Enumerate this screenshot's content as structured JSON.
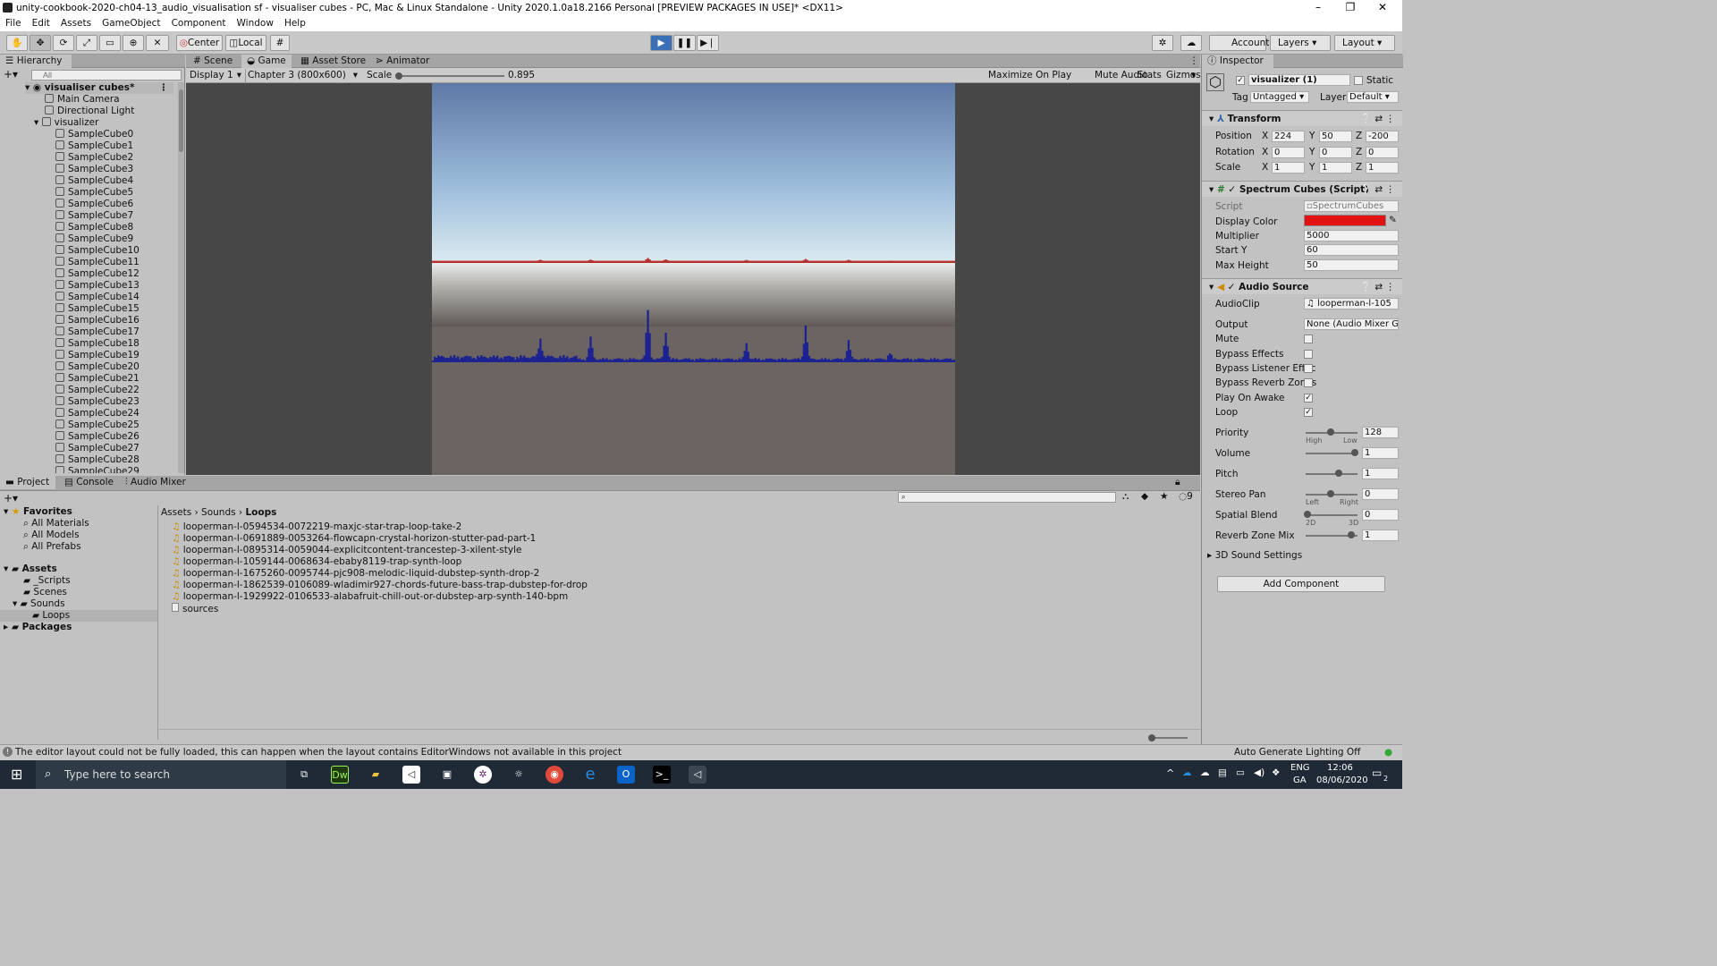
{
  "window": {
    "title": "unity-cookbook-2020-ch04-13_audio_visualisation sf - visualiser cubes - PC, Mac & Linux Standalone - Unity 2020.1.0a18.2166 Personal [PREVIEW PACKAGES IN USE]* <DX11>"
  },
  "menu": [
    "File",
    "Edit",
    "Assets",
    "GameObject",
    "Component",
    "Window",
    "Help"
  ],
  "toolbar": {
    "center": "Center",
    "local": "Local",
    "account": "Account",
    "layers": "Layers",
    "layout": "Layout"
  },
  "hierarchy": {
    "tab": "Hierarchy",
    "search_placeholder": "All",
    "scene": "visualiser cubes*",
    "objects": [
      "Main Camera",
      "Directional Light",
      "visualizer"
    ],
    "children": [
      "SampleCube0",
      "SampleCube1",
      "SampleCube2",
      "SampleCube3",
      "SampleCube4",
      "SampleCube5",
      "SampleCube6",
      "SampleCube7",
      "SampleCube8",
      "SampleCube9",
      "SampleCube10",
      "SampleCube11",
      "SampleCube12",
      "SampleCube13",
      "SampleCube14",
      "SampleCube15",
      "SampleCube16",
      "SampleCube17",
      "SampleCube18",
      "SampleCube19",
      "SampleCube20",
      "SampleCube21",
      "SampleCube22",
      "SampleCube23",
      "SampleCube24",
      "SampleCube25",
      "SampleCube26",
      "SampleCube27",
      "SampleCube28",
      "SampleCube29"
    ]
  },
  "game": {
    "tabs": [
      "Scene",
      "Game",
      "Asset Store",
      "Animator"
    ],
    "display": "Display 1",
    "resolution": "Chapter 3 (800x600)",
    "scale_label": "Scale",
    "scale_value": "0.895",
    "buttons": [
      "Maximize On Play",
      "Mute Audio",
      "Stats",
      "Gizmos"
    ],
    "spectrum_color_top": "#b53232",
    "spectrum_color_bottom": "#1c2290"
  },
  "project": {
    "tabs": [
      "Project",
      "Console",
      "Audio Mixer"
    ],
    "favorites_label": "Favorites",
    "favorites": [
      "All Materials",
      "All Models",
      "All Prefabs"
    ],
    "assets_label": "Assets",
    "asset_folders": [
      "_Scripts",
      "Scenes",
      "Sounds"
    ],
    "loops": "Loops",
    "packages": "Packages",
    "breadcrumb": [
      "Assets",
      "Sounds",
      "Loops"
    ],
    "files": [
      "looperman-l-0594534-0072219-maxjc-star-trap-loop-take-2",
      "looperman-l-0691889-0053264-flowcapn-crystal-horizon-stutter-pad-part-1",
      "looperman-l-0895314-0059044-explicitcontent-trancestep-3-xilent-style",
      "looperman-l-1059144-0068634-ebaby8119-trap-synth-loop",
      "looperman-l-1675260-0095744-pjc908-melodic-liquid-dubstep-synth-drop-2",
      "looperman-l-1862539-0106089-wladimir927-chords-future-bass-trap-dubstep-for-drop",
      "looperman-l-1929922-0106533-alabafruit-chill-out-or-dubstep-arp-synth-140-bpm"
    ],
    "other_file": "sources",
    "hidden_count": "9"
  },
  "inspector": {
    "tab": "Inspector",
    "object_name": "visualizer (1)",
    "static": "Static",
    "tag_label": "Tag",
    "tag": "Untagged",
    "layer_label": "Layer",
    "layer": "Default",
    "transform": {
      "title": "Transform",
      "position_label": "Position",
      "position": [
        "224",
        "50",
        "-200"
      ],
      "rotation_label": "Rotation",
      "rotation": [
        "0",
        "0",
        "0"
      ],
      "scale_label": "Scale",
      "scale": [
        "1",
        "1",
        "1"
      ]
    },
    "spectrum": {
      "title": "Spectrum Cubes (Script)",
      "script_label": "Script",
      "script": "SpectrumCubes",
      "color_label": "Display Color",
      "color": "#e31212",
      "multiplier_label": "Multiplier",
      "multiplier": "5000",
      "starty_label": "Start Y",
      "starty": "60",
      "maxheight_label": "Max Height",
      "maxheight": "50"
    },
    "audio": {
      "title": "Audio Source",
      "clip_label": "AudioClip",
      "clip": "looperman-l-105",
      "output_label": "Output",
      "output": "None (Audio Mixer G",
      "mute": "Mute",
      "bypass_effects": "Bypass Effects",
      "bypass_listener": "Bypass Listener Effec",
      "bypass_reverb": "Bypass Reverb Zones",
      "play_on_awake": "Play On Awake",
      "loop": "Loop",
      "priority_label": "Priority",
      "priority": "128",
      "priority_high": "High",
      "priority_low": "Low",
      "volume_label": "Volume",
      "volume": "1",
      "pitch_label": "Pitch",
      "pitch": "1",
      "stereo_label": "Stereo Pan",
      "stereo": "0",
      "stereo_left": "Left",
      "stereo_right": "Right",
      "spatial_label": "Spatial Blend",
      "spatial": "0",
      "spatial_2d": "2D",
      "spatial_3d": "3D",
      "reverb_label": "Reverb Zone Mix",
      "reverb": "1",
      "sound3d": "3D Sound Settings"
    },
    "add_component": "Add Component"
  },
  "status": {
    "message": "The editor layout could not be fully loaded, this can happen when the layout contains EditorWindows not available in this project",
    "lighting": "Auto Generate Lighting Off"
  },
  "taskbar": {
    "search_placeholder": "Type here to search",
    "lang": "ENG",
    "region": "GA",
    "time": "12:06",
    "date": "08/06/2020",
    "notifications": "2"
  }
}
